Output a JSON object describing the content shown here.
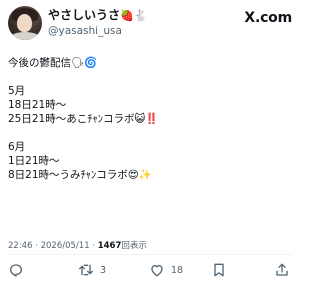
{
  "header": {
    "display_name": "やさしいうさ",
    "name_emojis": "🍓🐇",
    "handle": "@yasashi_usa",
    "platform_logo": "X.com"
  },
  "tweet": {
    "lines": [
      "今後の鬱配信🗣🌀",
      "",
      "5月",
      "18日21時〜",
      "25日21時〜あこﾁｬﾝコラボ😺‼️",
      "",
      "6月",
      "1日21時〜",
      "8日21時〜うみﾁｬﾝコラボ😍✨"
    ]
  },
  "meta": {
    "time": "22:46",
    "date": "2026/05/11",
    "views_count": "1467",
    "views_label": "回表示"
  },
  "actions": {
    "reply_count": "",
    "retweet_count": "3",
    "like_count": "18"
  },
  "icons": {
    "reply": "reply-icon",
    "retweet": "retweet-icon",
    "like": "heart-icon",
    "bookmark": "bookmark-icon",
    "share": "share-icon"
  }
}
